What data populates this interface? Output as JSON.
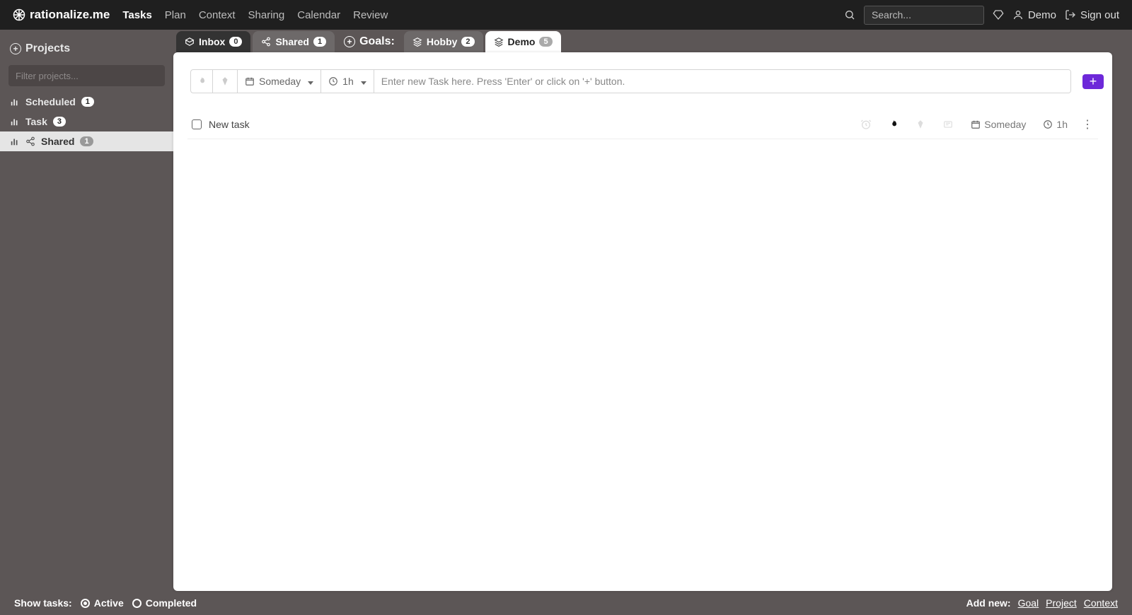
{
  "brand": "rationalize.me",
  "nav": {
    "tasks": "Tasks",
    "plan": "Plan",
    "context": "Context",
    "sharing": "Sharing",
    "calendar": "Calendar",
    "review": "Review"
  },
  "search_placeholder": "Search...",
  "user": {
    "name": "Demo",
    "signout": "Sign out"
  },
  "sidebar": {
    "title": "Projects",
    "filter_placeholder": "Filter projects...",
    "items": [
      {
        "label": "Scheduled",
        "count": "1"
      },
      {
        "label": "Task",
        "count": "3"
      },
      {
        "label": "Shared",
        "count": "1"
      }
    ]
  },
  "tabs": {
    "inbox": {
      "label": "Inbox",
      "count": "0"
    },
    "shared": {
      "label": "Shared",
      "count": "1"
    },
    "goals_label": "Goals:",
    "hobby": {
      "label": "Hobby",
      "count": "2"
    },
    "demo": {
      "label": "Demo",
      "count": "5"
    }
  },
  "newtask": {
    "someday": "Someday",
    "duration": "1h",
    "placeholder": "Enter new Task here. Press 'Enter' or click on '+' button."
  },
  "task_row": {
    "name": "New task",
    "someday": "Someday",
    "duration": "1h"
  },
  "footer": {
    "show_tasks": "Show tasks:",
    "active": "Active",
    "completed": "Completed",
    "add_new": "Add new:",
    "goal": "Goal",
    "project": "Project",
    "context": "Context"
  }
}
